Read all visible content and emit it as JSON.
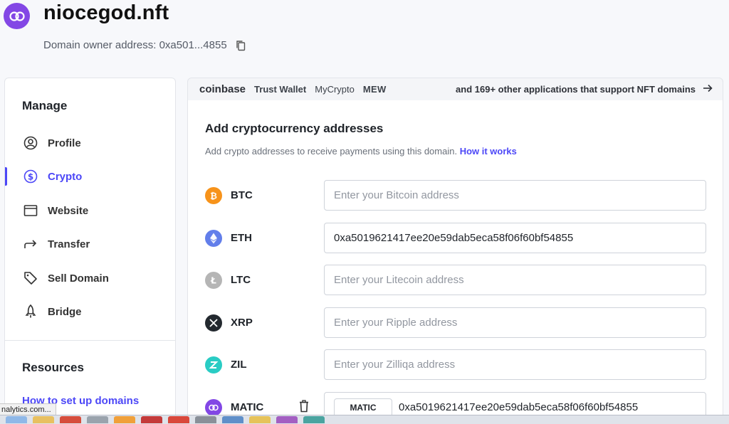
{
  "header": {
    "domain": "niocegod.nft",
    "owner_label": "Domain owner address: 0xa501...4855"
  },
  "sidebar": {
    "manage_heading": "Manage",
    "items": [
      {
        "label": "Profile",
        "icon": "user-circle-icon"
      },
      {
        "label": "Crypto",
        "icon": "dollar-circle-icon",
        "active": true
      },
      {
        "label": "Website",
        "icon": "browser-window-icon"
      },
      {
        "label": "Transfer",
        "icon": "arrow-transfer-icon"
      },
      {
        "label": "Sell Domain",
        "icon": "tag-icon"
      },
      {
        "label": "Bridge",
        "icon": "rocket-icon"
      }
    ],
    "resources_heading": "Resources",
    "resource_link": "How to set up domains"
  },
  "apps_bar": {
    "apps": [
      "coinbase",
      "Trust Wallet",
      "MyCrypto",
      "MEW"
    ],
    "more": "and 169+ other applications that support NFT domains"
  },
  "main": {
    "title": "Add cryptocurrency addresses",
    "subtitle": "Add crypto addresses to receive payments using this domain.",
    "how_link": "How it works",
    "coins": [
      {
        "symbol": "BTC",
        "placeholder": "Enter your Bitcoin address",
        "value": "",
        "color": "#f7931a"
      },
      {
        "symbol": "ETH",
        "placeholder": "",
        "value": "0xa5019621417ee20e59dab5eca58f06f60bf54855",
        "color": "#627eea"
      },
      {
        "symbol": "LTC",
        "placeholder": "Enter your Litecoin address",
        "value": "",
        "color": "#b5b5b5"
      },
      {
        "symbol": "XRP",
        "placeholder": "Enter your Ripple address",
        "value": "",
        "color": "#23292f"
      },
      {
        "symbol": "ZIL",
        "placeholder": "Enter your Zilliqa address",
        "value": "",
        "color": "#29ccc4"
      },
      {
        "symbol": "MATIC",
        "placeholder": "",
        "value": "0xa5019621417ee20e59dab5eca58f06f60bf54855",
        "chip": "MATIC",
        "color": "#8247e5"
      }
    ]
  },
  "status_tip": "nalytics.com...",
  "colors": {
    "accent": "#4c47f7",
    "brand": "#8347e5"
  }
}
